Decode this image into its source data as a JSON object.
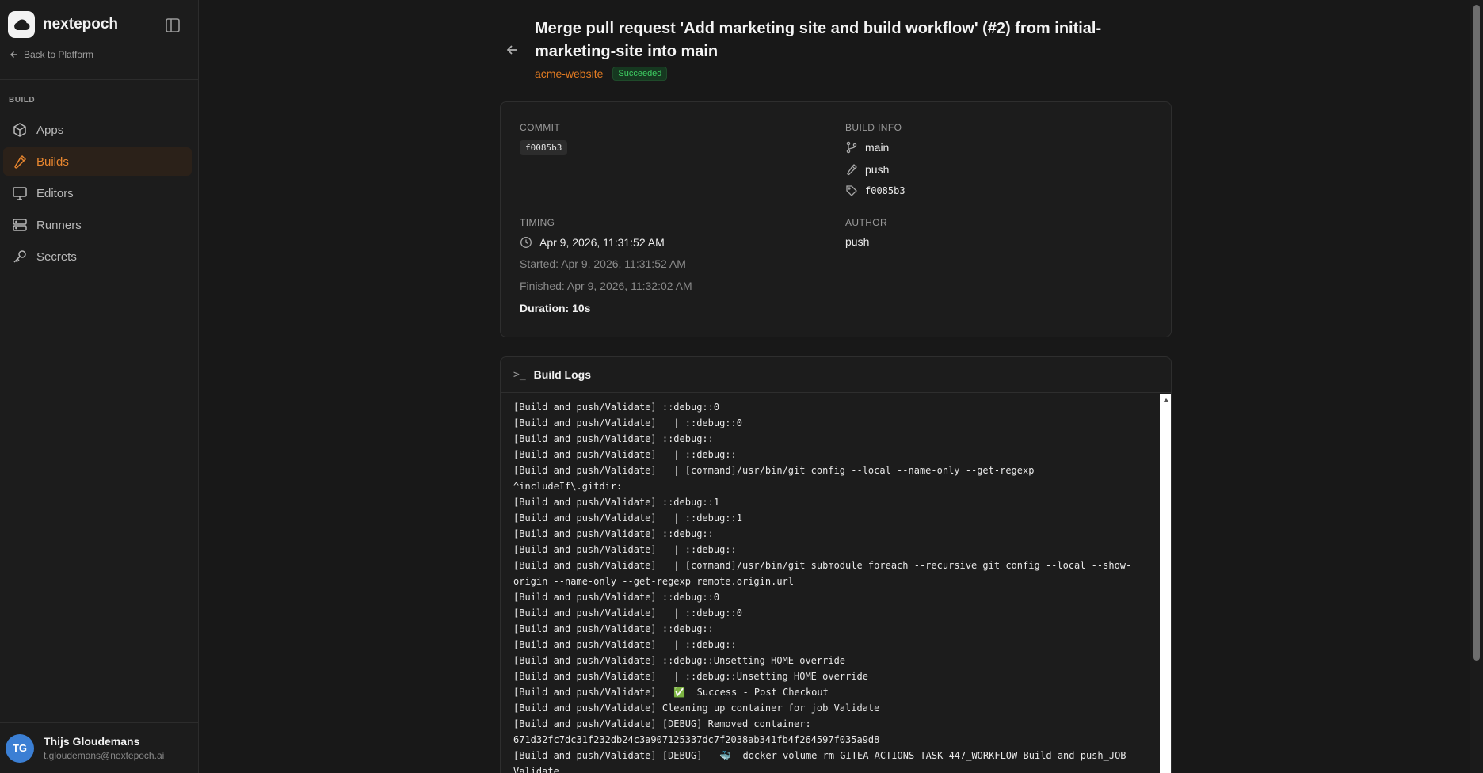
{
  "sidebar": {
    "brand": "nextepoch",
    "back_label": "Back to Platform",
    "section_label": "BUILD",
    "items": [
      {
        "label": "Apps",
        "icon": "box-icon",
        "active": false
      },
      {
        "label": "Builds",
        "icon": "hammer-icon",
        "active": true
      },
      {
        "label": "Editors",
        "icon": "monitor-icon",
        "active": false
      },
      {
        "label": "Runners",
        "icon": "server-icon",
        "active": false
      },
      {
        "label": "Secrets",
        "icon": "key-icon",
        "active": false
      }
    ],
    "user": {
      "initials": "TG",
      "name": "Thijs Gloudemans",
      "email": "t.gloudemans@nextepoch.ai"
    }
  },
  "header": {
    "title": "Merge pull request 'Add marketing site and build workflow' (#2) from initial-marketing-site into main",
    "repo": "acme-website",
    "status": "Succeeded"
  },
  "info": {
    "commit_label": "COMMIT",
    "commit_hash": "f0085b3",
    "build_info_label": "BUILD INFO",
    "branch": "main",
    "trigger": "push",
    "tag": "f0085b3",
    "timing_label": "TIMING",
    "timestamp": "Apr 9, 2026, 11:31:52 AM",
    "started": "Started: Apr 9, 2026, 11:31:52 AM",
    "finished": "Finished: Apr 9, 2026, 11:32:02 AM",
    "duration": "Duration: 10s",
    "author_label": "AUTHOR",
    "author": "push"
  },
  "logs": {
    "prompt": ">_",
    "title": "Build Logs",
    "lines": [
      "[Build and push/Validate] ::debug::0",
      "[Build and push/Validate]   | ::debug::0",
      "[Build and push/Validate] ::debug::",
      "[Build and push/Validate]   | ::debug::",
      "[Build and push/Validate]   | [command]/usr/bin/git config --local --name-only --get-regexp",
      "^includeIf\\.gitdir:",
      "[Build and push/Validate] ::debug::1",
      "[Build and push/Validate]   | ::debug::1",
      "[Build and push/Validate] ::debug::",
      "[Build and push/Validate]   | ::debug::",
      "[Build and push/Validate]   | [command]/usr/bin/git submodule foreach --recursive git config --local --show-",
      "origin --name-only --get-regexp remote.origin.url",
      "[Build and push/Validate] ::debug::0",
      "[Build and push/Validate]   | ::debug::0",
      "[Build and push/Validate] ::debug::",
      "[Build and push/Validate]   | ::debug::",
      "[Build and push/Validate] ::debug::Unsetting HOME override",
      "[Build and push/Validate]   | ::debug::Unsetting HOME override",
      "[Build and push/Validate]   ✅  Success - Post Checkout",
      "[Build and push/Validate] Cleaning up container for job Validate",
      "[Build and push/Validate] [DEBUG] Removed container:",
      "671d32fc7dc31f232db24c3a907125337dc7f2038ab341fb4f264597f035a9d8",
      "[Build and push/Validate] [DEBUG]   🐳  docker volume rm GITEA-ACTIONS-TASK-447_WORKFLOW-Build-and-push_JOB-",
      "Validate"
    ]
  },
  "colors": {
    "accent": "#e8862f",
    "success": "#3fcf63",
    "avatar": "#3b7fd4"
  }
}
